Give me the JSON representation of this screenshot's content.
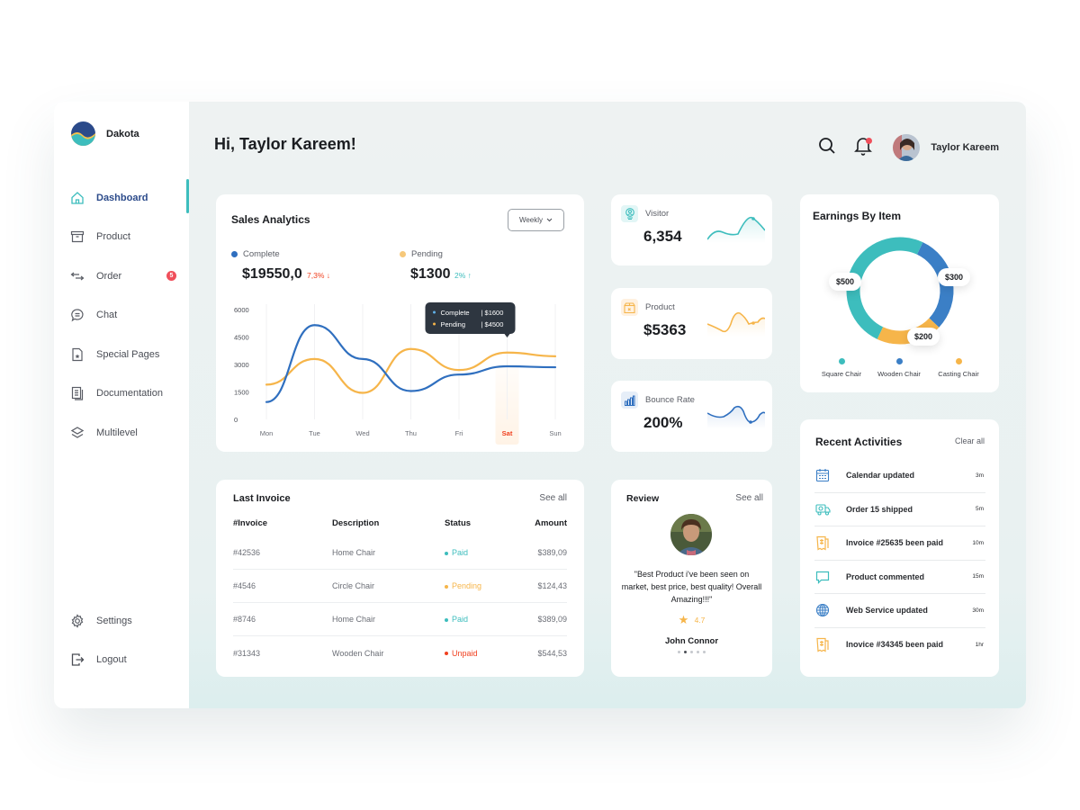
{
  "brand": {
    "name": "Dakota"
  },
  "sidebar": {
    "items": [
      {
        "label": "Dashboard",
        "icon": "home-icon",
        "active": true
      },
      {
        "label": "Product",
        "icon": "box-icon"
      },
      {
        "label": "Order",
        "icon": "arrows-exchange-icon",
        "badge": "5"
      },
      {
        "label": "Chat",
        "icon": "chat-bubble-icon"
      },
      {
        "label": "Special Pages",
        "icon": "star-document-icon"
      },
      {
        "label": "Documentation",
        "icon": "documents-icon"
      },
      {
        "label": "Multilevel",
        "icon": "layers-icon"
      }
    ],
    "bottom": [
      {
        "label": "Settings",
        "icon": "gear-icon"
      },
      {
        "label": "Logout",
        "icon": "logout-icon"
      }
    ]
  },
  "header": {
    "greeting": "Hi, Taylor Kareem!",
    "user_name": "Taylor Kareem"
  },
  "sales": {
    "title": "Sales Analytics",
    "period": "Weekly",
    "complete_label": "Complete",
    "complete_value": "$19550,0",
    "complete_delta": "7,3% ↓",
    "pending_label": "Pending",
    "pending_value": "$1300",
    "pending_delta": "2% ↑",
    "tooltip": {
      "complete": "Complete",
      "complete_val": "$1600",
      "pending": "Pending",
      "pending_val": "$4500"
    }
  },
  "chart_data": {
    "type": "line",
    "title": "Sales Analytics",
    "categories": [
      "Mon",
      "Tue",
      "Wed",
      "Thu",
      "Fri",
      "Sat",
      "Sun"
    ],
    "highlight": "Sat",
    "yticks": [
      0,
      1500,
      3000,
      4500,
      6000
    ],
    "ylim": [
      0,
      6000
    ],
    "series": [
      {
        "name": "Complete",
        "color": "#2f6fbf",
        "values": [
          950,
          5150,
          3300,
          1550,
          2450,
          2900,
          2850
        ]
      },
      {
        "name": "Pending",
        "color": "#f6b54a",
        "values": [
          1900,
          3300,
          1450,
          3850,
          2700,
          3650,
          3450
        ]
      }
    ]
  },
  "stats": [
    {
      "label": "Visitor",
      "value": "6,354",
      "icon": "visitor-icon",
      "color": "#3dbdbd"
    },
    {
      "label": "Product",
      "value": "$5363",
      "icon": "product-box-icon",
      "color": "#f6b54a"
    },
    {
      "label": "Bounce Rate",
      "value": "200%",
      "icon": "bar-chart-icon",
      "color": "#2f6fbf"
    }
  ],
  "earnings": {
    "title": "Earnings By Item",
    "items": [
      {
        "name": "Square Chair",
        "value": 500,
        "label": "$500",
        "color": "#3dbdbd"
      },
      {
        "name": "Wooden Chair",
        "value": 300,
        "label": "$300",
        "color": "#3b7fc6"
      },
      {
        "name": "Casting Chair",
        "value": 200,
        "label": "$200",
        "color": "#f6b54a"
      }
    ]
  },
  "activities": {
    "title": "Recent Activities",
    "clear_label": "Clear all",
    "items": [
      {
        "text": "Calendar updated",
        "time": "3m",
        "icon": "calendar-icon"
      },
      {
        "text": "Order 15 shipped",
        "time": "5m",
        "icon": "truck-icon"
      },
      {
        "text": "Invoice #25635 been paid",
        "time": "10m",
        "icon": "invoice-icon"
      },
      {
        "text": "Product commented",
        "time": "15m",
        "icon": "comment-icon"
      },
      {
        "text": "Web Service updated",
        "time": "30m",
        "icon": "globe-icon"
      },
      {
        "text": "Inovice #34345 been paid",
        "time": "1hr",
        "icon": "invoice-icon"
      }
    ]
  },
  "invoice": {
    "title": "Last Invoice",
    "see_all": "See all",
    "columns": [
      "#Invoice",
      "Description",
      "Status",
      "Amount"
    ],
    "rows": [
      {
        "id": "#42536",
        "desc": "Home Chair",
        "status": "Paid",
        "amount": "$389,09"
      },
      {
        "id": "#4546",
        "desc": "Circle Chair",
        "status": "Pending",
        "amount": "$124,43"
      },
      {
        "id": "#8746",
        "desc": "Home Chair",
        "status": "Paid",
        "amount": "$389,09"
      },
      {
        "id": "#31343",
        "desc": "Wooden Chair",
        "status": "Unpaid",
        "amount": "$544,53"
      }
    ],
    "status_colors": {
      "Paid": "#3dbdbd",
      "Pending": "#f6b54a",
      "Unpaid": "#f0401f"
    }
  },
  "review": {
    "title": "Review",
    "see_all": "See all",
    "text": "\"Best Product i've been seen on market, best price, best quality! Overall Amazing!!!\"",
    "rating": "4.7",
    "name": "John Connor",
    "page": 2,
    "pages": 5
  }
}
